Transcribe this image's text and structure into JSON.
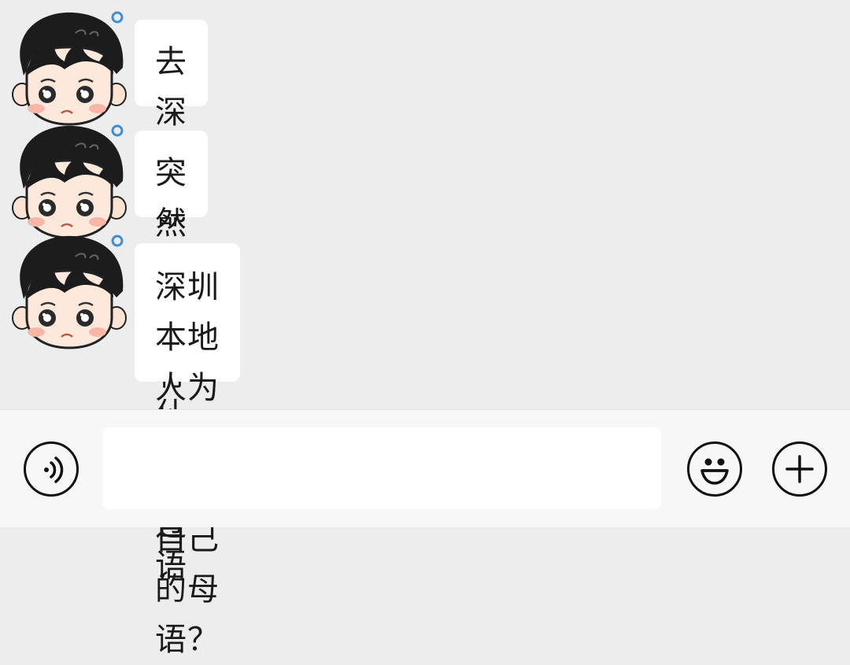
{
  "messages": [
    {
      "sender": "cartoon-boy-avatar",
      "text": "去深圳都听不到什么粤语"
    },
    {
      "sender": "cartoon-boy-avatar",
      "text": "突然觉得有点难过"
    },
    {
      "sender": "cartoon-boy-avatar",
      "lines": [
        "深圳本地人为什么不说自己的母",
        "语？"
      ]
    }
  ],
  "input_bar": {
    "value": "",
    "placeholder": "",
    "voice_icon": "voice-icon",
    "emoji_icon": "emoji-icon",
    "more_icon": "plus-icon"
  },
  "colors": {
    "chat_background": "#ededed",
    "bubble": "#ffffff",
    "bottom_bar": "#f7f7f7"
  }
}
